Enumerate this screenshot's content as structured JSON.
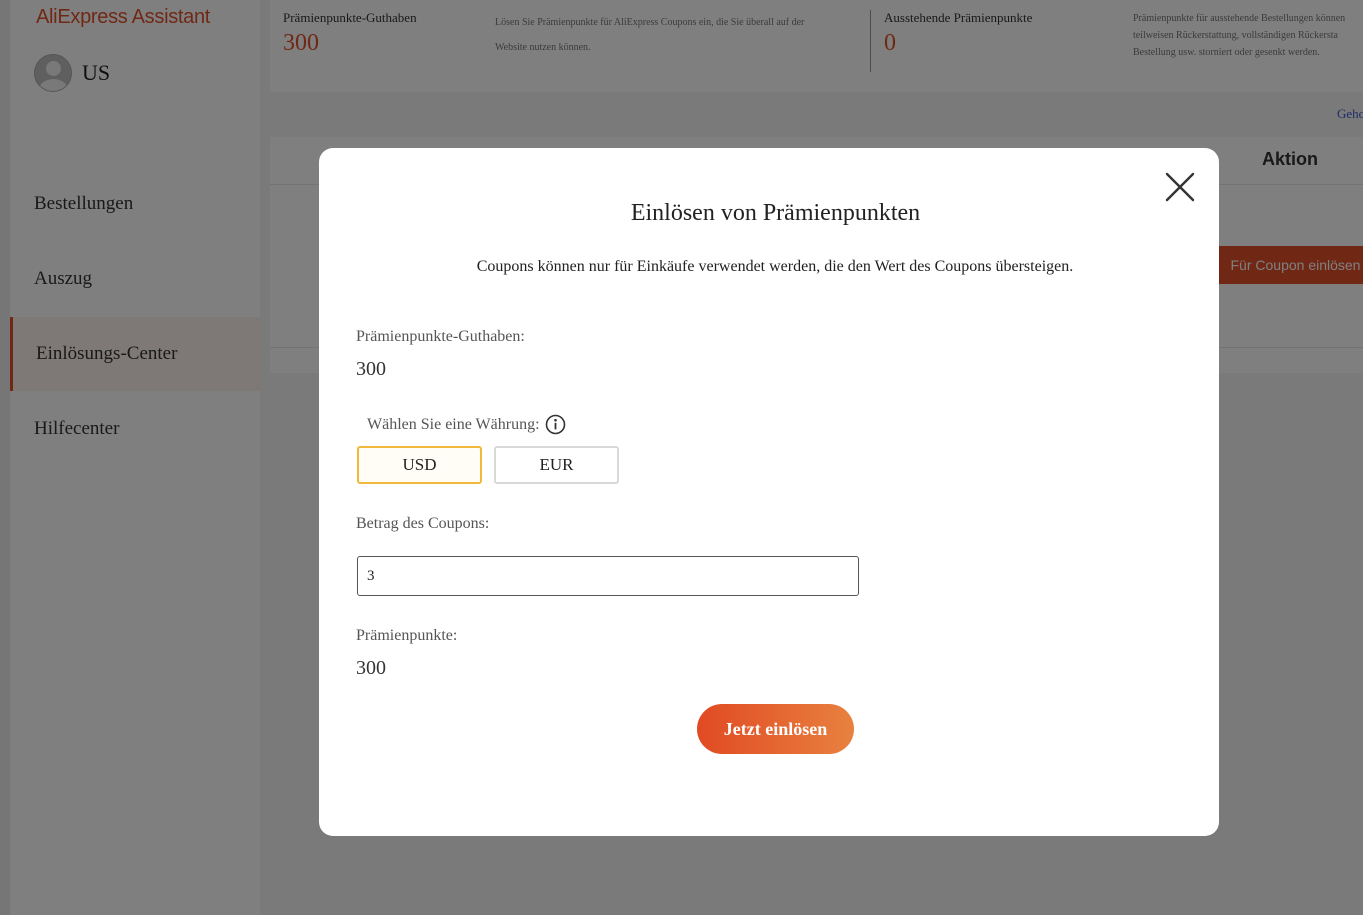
{
  "app": {
    "brand": "AliExpress Assistant",
    "user_name": "US"
  },
  "sidebar": {
    "items": [
      {
        "label": "Bestellungen"
      },
      {
        "label": "Auszug"
      },
      {
        "label": "Einlösungs-Center",
        "active": true
      },
      {
        "label": "Hilfecenter"
      }
    ]
  },
  "summary": {
    "balance_label": "Prämienpunkte-Guthaben",
    "balance_value": "300",
    "balance_desc_line1": "Lösen Sie Prämienpunkte für AliExpress Coupons ein, die Sie überall auf der",
    "balance_desc_line2": "Website nutzen können.",
    "pending_label": "Ausstehende Prämienpunkte",
    "pending_value": "0",
    "pending_desc_line1": "Prämienpunkte für ausstehende Bestellungen können",
    "pending_desc_line2": "teilweisen Rückerstattung, vollständigen Rückersta",
    "pending_desc_line3": "Bestellung usw. storniert oder gesenkt werden.",
    "more_link": "Geho"
  },
  "table": {
    "action_header": "Aktion",
    "coupon_button": "Für Coupon einlösen"
  },
  "modal": {
    "title": "Einlösen von Prämienpunkten",
    "subtitle": "Coupons können nur für Einkäufe verwendet werden, die den Wert des Coupons übersteigen.",
    "balance_label": "Prämienpunkte-Guthaben:",
    "balance_value": "300",
    "currency_label": "Wählen Sie eine Währung:",
    "currencies": [
      "USD",
      "EUR"
    ],
    "selected_currency": "USD",
    "amount_label": "Betrag des Coupons:",
    "amount_value": "3",
    "points_label": "Prämienpunkte:",
    "points_value": "300",
    "redeem_button": "Jetzt einlösen"
  },
  "colors": {
    "accent": "#e0502a",
    "selected_border": "#f0b93c",
    "link": "#3a5bd0"
  }
}
